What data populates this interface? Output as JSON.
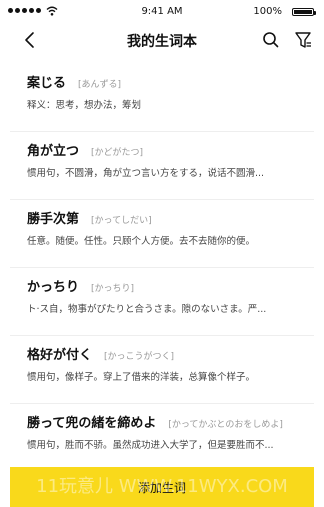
{
  "status_bar": {
    "time": "9:41 AM",
    "battery": "100%",
    "battery_level": 1.0
  },
  "nav": {
    "title": "我的生词本",
    "back_icon": "chevron-left-icon",
    "search_icon": "search-icon",
    "filter_icon": "filter-icon"
  },
  "words": [
    {
      "title": "案じる",
      "reading": "[あんずる]",
      "meaning": "释义：思考，想办法，筹划"
    },
    {
      "title": "角が立つ",
      "reading": "[かどがたつ]",
      "meaning": "惯用句，不圆滑，角が立つ言い方をする，说话不圆滑..."
    },
    {
      "title": "勝手次第",
      "reading": "[かってしだい]",
      "meaning": "任意。随便。任性。只顾个人方便。去不去随你的便。"
    },
    {
      "title": "かっちり",
      "reading": "[かっちり]",
      "meaning": "ト·ス自，物事がぴたりと合うさま。隙のないさま。严..."
    },
    {
      "title": "格好が付く",
      "reading": "[かっこうがつく]",
      "meaning": "惯用句，像样子。穿上了借来的洋装，总算像个样子。"
    },
    {
      "title": "勝って兜の緒を締めよ",
      "reading": "[かってかぶとのおをしめよ]",
      "meaning": "惯用句，胜而不骄。虽然成功进入大学了，但是要胜而不..."
    }
  ],
  "add_button": {
    "label": "添加生词"
  },
  "watermark": "11玩意儿 WWW.11WYX.COM",
  "colors": {
    "accent": "#f9d91b",
    "text": "#111111",
    "reading": "#999999"
  }
}
